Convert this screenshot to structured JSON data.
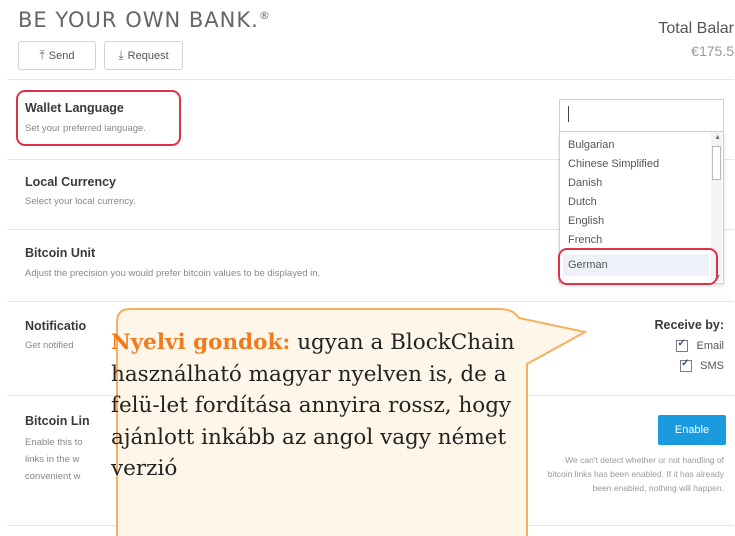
{
  "brand": {
    "name": "BE YOUR OWN BANK.",
    "mark": "®"
  },
  "actions": {
    "send": "Send",
    "request": "Request"
  },
  "balance": {
    "label": "Total Balar",
    "amount": "€175.5"
  },
  "sections": {
    "language": {
      "title": "Wallet Language",
      "desc": "Set your preferred language."
    },
    "currency": {
      "title": "Local Currency",
      "desc": "Select your local currency."
    },
    "unit": {
      "title": "Bitcoin Unit",
      "desc": "Adjust the precision you would prefer bitcoin values to be displayed in."
    },
    "notifications": {
      "title": "Notificatio",
      "desc": "Get notified"
    },
    "links": {
      "title": "Bitcoin Lin",
      "desc_lines": [
        "Enable this to",
        "links in the w",
        "convenient w"
      ]
    }
  },
  "language_dropdown": {
    "input_value": "",
    "options": [
      "Bulgarian",
      "Chinese Simplified",
      "Danish",
      "Dutch",
      "English",
      "French",
      "German"
    ],
    "selected": "German"
  },
  "receive": {
    "label": "Receive by:",
    "options": [
      {
        "label": "Email",
        "checked": true
      },
      {
        "label": "SMS",
        "checked": true
      }
    ]
  },
  "enable_button": "Enable",
  "links_note": "We can't detect whether or not handling of bitcoin links has been enabled. If it has already been enabled, nothing will happen.",
  "callout": {
    "highlight": "Nyelvi gondok:",
    "text": " ugyan a BlockChain használható magyar nyelven is, de a felü-let fordítása annyira rossz, hogy ajánlott inkább az angol vagy német verzió",
    "highlight_color": "#f07a1e",
    "border_color": "#f6b060",
    "fill_color": "#fef6e8"
  },
  "colors": {
    "accent_red": "#e0314b",
    "enable_blue": "#1a9be0"
  },
  "icons": {
    "send": "send-icon",
    "request": "request-icon",
    "checkbox": "checkmark-icon"
  }
}
